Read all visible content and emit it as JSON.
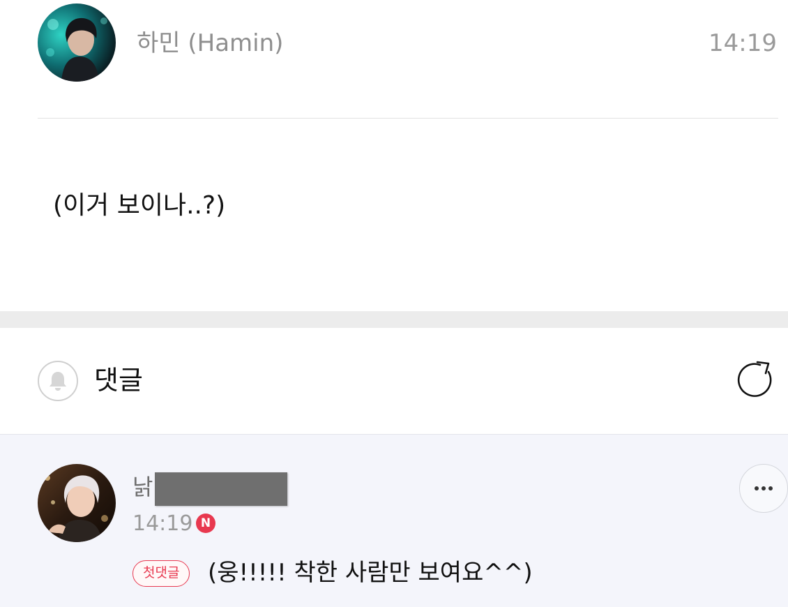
{
  "post": {
    "author_name": "하민 (Hamin)",
    "time": "14:19",
    "body": "(이거 보이나..?)"
  },
  "comments_section": {
    "title": "댓글",
    "bell_icon": "bell-icon",
    "refresh_icon": "refresh-icon"
  },
  "comment": {
    "author_name_visible": "낡",
    "time": "14:19",
    "new_badge": "N",
    "first_comment_badge": "첫댓글",
    "text": "(웅!!!!! 착한 사람만 보여요^^)",
    "more_icon": "more-icon"
  },
  "colors": {
    "accent_red": "#e8384f",
    "comment_background": "#f4f5fb",
    "muted_text": "#8e8e8e"
  }
}
